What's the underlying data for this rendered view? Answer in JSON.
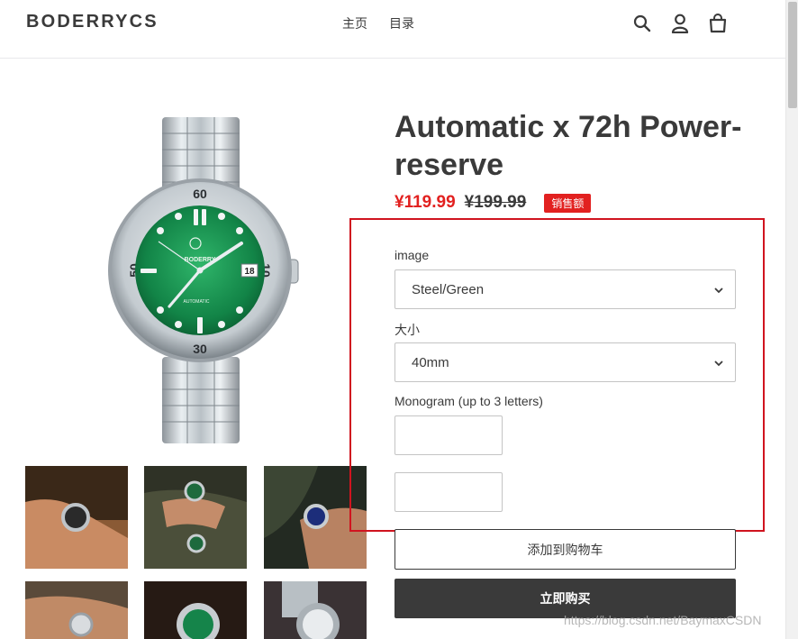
{
  "header": {
    "logo": "BODERRYCS",
    "nav": [
      "主页",
      "目录"
    ],
    "icons": [
      "search-icon",
      "account-icon",
      "cart-icon"
    ]
  },
  "product": {
    "title": "Automatic x 72h Power-reserve",
    "sale_price": "¥119.99",
    "compare_price": "¥199.99",
    "badge": "销售额",
    "watch_dial_brand": "BODERRY",
    "watch_dial_text": "AUTOMATIC",
    "watch_date": "18"
  },
  "options": {
    "image_label": "image",
    "image_value": "Steel/Green",
    "size_label": "大小",
    "size_value": "40mm",
    "monogram_label": "Monogram (up to 3 letters)"
  },
  "buttons": {
    "add_to_cart": "添加到购物车",
    "buy_now": "立即购买"
  },
  "watermark": "https://blog.csdn.net/BaymaxCSDN",
  "colors": {
    "accent_red": "#e22120",
    "text_dark": "#3a3a3a",
    "frame_red": "#d0141f",
    "dial_green": "#1f9a55"
  }
}
